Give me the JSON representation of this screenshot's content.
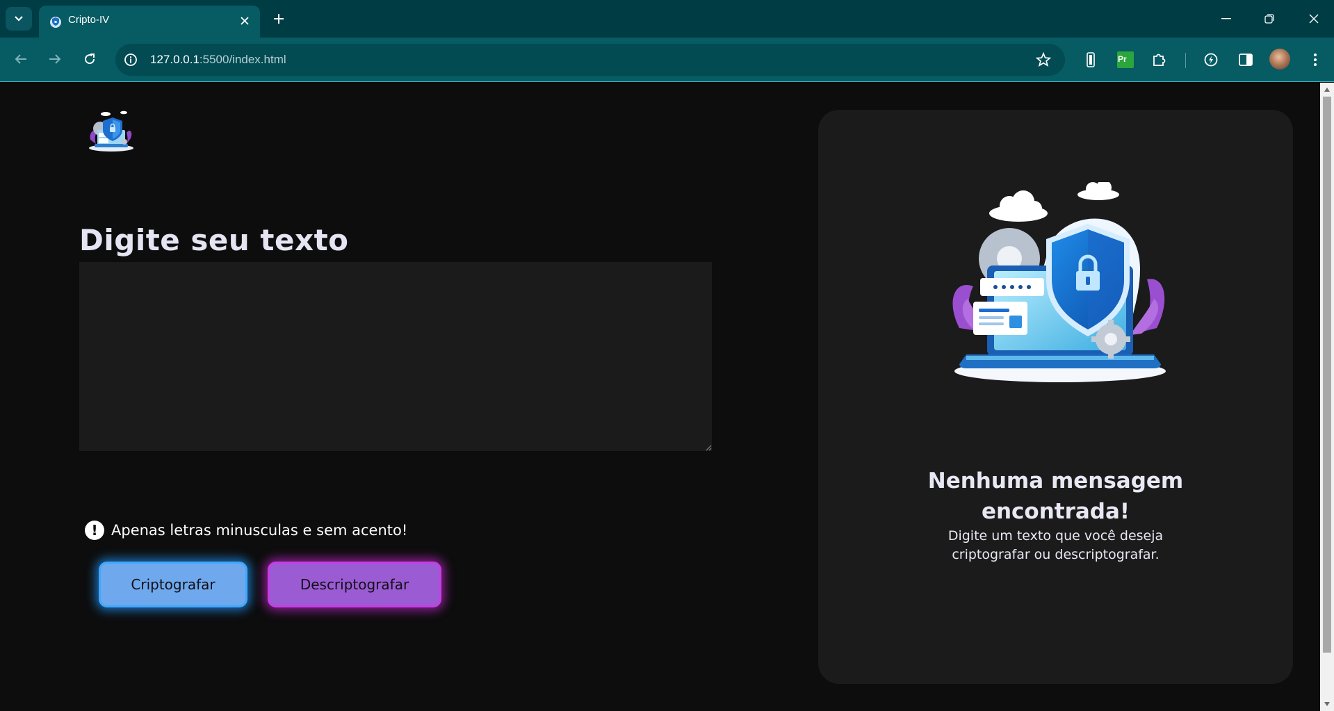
{
  "browser": {
    "tab": {
      "title": "Cripto-IV"
    },
    "address": {
      "host": "127.0.0.1",
      "path": ":5500/index.html"
    },
    "icons": {
      "tab_list": "chevron-down-icon",
      "favicon": "shield-favicon",
      "close": "close-icon",
      "new_tab": "plus-icon",
      "back": "back-arrow-icon",
      "forward": "forward-arrow-icon",
      "reload": "reload-icon",
      "info": "info-icon",
      "bookmark": "star-icon"
    },
    "extensions": {
      "premiere_label": "Pr"
    },
    "colors": {
      "tabbar": "#003c44",
      "toolbar": "#075b63",
      "omnibox": "#024b53"
    }
  },
  "main": {
    "heading": "Digite seu texto",
    "textarea_value": "",
    "warning": "Apenas letras minusculas e sem acento!",
    "encrypt_button": "Criptografar",
    "decrypt_button": "Descriptografar"
  },
  "output": {
    "title_line1": "Nenhuma mensagem",
    "title_line2": "encontrada!",
    "desc_line1": "Digite um texto que você deseja",
    "desc_line2": "criptografar ou descriptografar."
  },
  "colors": {
    "page_bg": "#0d0d0d",
    "panel_bg": "#1b1b1b",
    "encrypt_btn": "#6fa8ec",
    "decrypt_btn": "#9b5bd2"
  }
}
